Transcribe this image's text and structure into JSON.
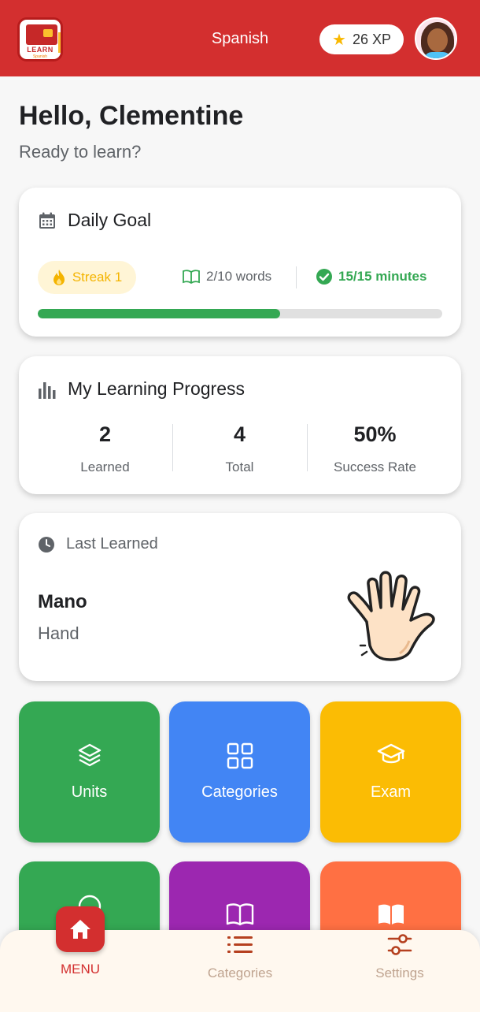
{
  "header": {
    "logo_text": "LEARN",
    "logo_subtext": "Spanish",
    "language": "Spanish",
    "xp_label": "26 XP",
    "star_icon": "star-icon",
    "avatar_icon": "user-avatar"
  },
  "greeting": {
    "title": "Hello, Clementine",
    "subtitle": "Ready to learn?"
  },
  "daily_goal": {
    "title": "Daily Goal",
    "icon": "calendar-icon",
    "streak_label": "Streak 1",
    "words_label": "2/10 words",
    "minutes_label": "15/15 minutes",
    "progress_fraction": 0.6,
    "colors": {
      "streak": "#f4b400",
      "success": "#34a853"
    }
  },
  "progress": {
    "title": "My Learning Progress",
    "icon": "bar-chart-icon",
    "stats": [
      {
        "value": "2",
        "label": "Learned"
      },
      {
        "value": "4",
        "label": "Total"
      },
      {
        "value": "50%",
        "label": "Success Rate"
      }
    ]
  },
  "last_learned": {
    "title": "Last Learned",
    "icon": "clock-icon",
    "word": "Mano",
    "translation": "Hand",
    "image_icon": "hand-icon"
  },
  "tiles": [
    {
      "label": "Units",
      "icon": "layers-icon",
      "color": "#34a853"
    },
    {
      "label": "Categories",
      "icon": "grid-icon",
      "color": "#4285f4"
    },
    {
      "label": "Exam",
      "icon": "graduation-cap-icon",
      "color": "#fbbc04"
    },
    {
      "label": "",
      "icon": "chat-icon",
      "color": "#34a853"
    },
    {
      "label": "",
      "icon": "book-icon",
      "color": "#9c27b0"
    },
    {
      "label": "",
      "icon": "open-book-icon",
      "color": "#ff7043"
    }
  ],
  "bottom_nav": {
    "items": [
      {
        "label": "MENU",
        "icon": "home-icon",
        "active": true
      },
      {
        "label": "Categories",
        "icon": "list-icon",
        "active": false
      },
      {
        "label": "Settings",
        "icon": "sliders-icon",
        "active": false
      }
    ],
    "colors": {
      "active": "#d32f2f",
      "inactive": "#bfa38f"
    }
  }
}
